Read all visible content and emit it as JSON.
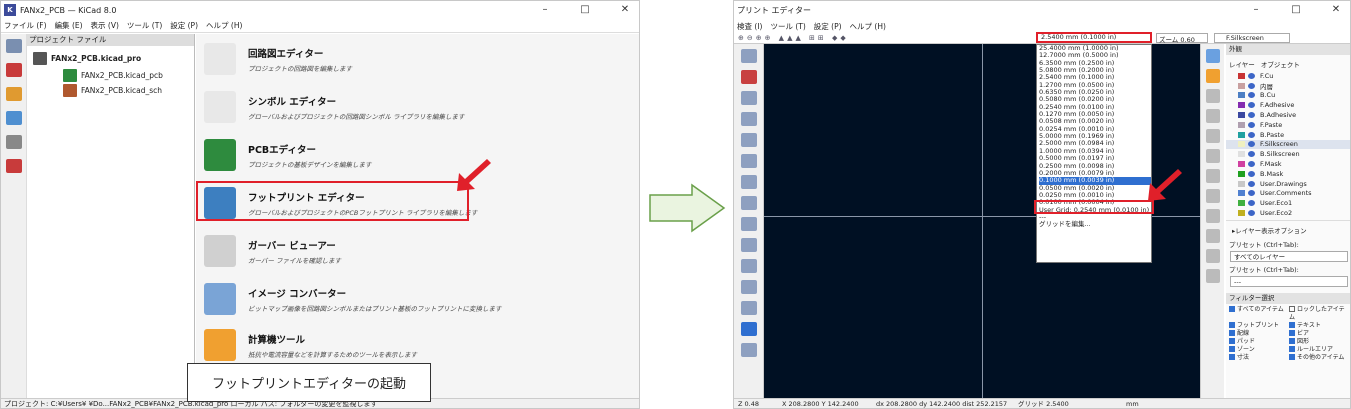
{
  "left_window": {
    "app_icon": "K",
    "title": "FANx2_PCB — KiCad 8.0",
    "menu": [
      "ファイル (F)",
      "編集 (E)",
      "表示 (V)",
      "ツール (T)",
      "設定 (P)",
      "ヘルプ (H)"
    ],
    "tree_header": "プロジェクト ファイル",
    "tree": [
      "FANx2_PCB.kicad_pro",
      "FANx2_PCB.kicad_pcb",
      "FANx2_PCB.kicad_sch"
    ],
    "launchers": [
      {
        "title": "回路図エディター",
        "desc": "プロジェクトの回路図を編集します",
        "icon": "schematic-icon",
        "color": "#e8e8e8"
      },
      {
        "title": "シンボル エディター",
        "desc": "グローバルおよびプロジェクトの回路図シンボル ライブラリを編集します",
        "icon": "symbol-icon",
        "color": "#e8e8e8"
      },
      {
        "title": "PCBエディター",
        "desc": "プロジェクトの基板デザインを編集します",
        "icon": "pcb-icon",
        "color": "#2e8b3e"
      },
      {
        "title": "フットプリント エディター",
        "desc": "グローバルおよびプロジェクトのPCBフットプリント ライブラリを編集します",
        "icon": "footprint-icon",
        "color": "#3d7fc0"
      },
      {
        "title": "ガーバー ビューアー",
        "desc": "ガーバー ファイルを確認します",
        "icon": "gerber-icon",
        "color": "#d0d0d0"
      },
      {
        "title": "イメージ コンバーター",
        "desc": "ビットマップ画像を回路図シンボルまたはプリント基板のフットプリントに変換します",
        "icon": "image-converter-icon",
        "color": "#7aa4d6"
      },
      {
        "title": "計算機ツール",
        "desc": "抵抗や電流容量などを計算するためのツールを表示します",
        "icon": "calculator-icon",
        "color": "#f0a030"
      }
    ],
    "status": "プロジェクト: C:¥Users¥        ¥Do...FANx2_PCB¥FANx2_PCB.kicad_pro    ローカル パス: フォルダーの変更を監視します",
    "callout": "フットプリントエディターの起動"
  },
  "right_window": {
    "title": "プリント エディター",
    "menu": [
      "検査 (I)",
      "ツール (T)",
      "設定 (P)",
      "ヘルプ (H)"
    ],
    "grid_select": "2.5400 mm (0.1000 in)",
    "zoom_select": "ズーム 0.60",
    "layer_select": "F.Silkscreen",
    "grid_options": [
      "25.4000 mm (1.0000 in)",
      "12.7000 mm (0.5000 in)",
      "6.3500 mm (0.2500 in)",
      "5.0800 mm (0.2000 in)",
      "2.5400 mm (0.1000 in)",
      "1.2700 mm (0.0500 in)",
      "0.6350 mm (0.0250 in)",
      "0.5080 mm (0.0200 in)",
      "0.2540 mm (0.0100 in)",
      "0.1270 mm (0.0050 in)",
      "0.0508 mm (0.0020 in)",
      "0.0254 mm (0.0010 in)",
      "5.0000 mm (0.1969 in)",
      "2.5000 mm (0.0984 in)",
      "1.0000 mm (0.0394 in)",
      "0.5000 mm (0.0197 in)",
      "0.2500 mm (0.0098 in)",
      "0.2000 mm (0.0079 in)",
      "0.1000 mm (0.0039 in)",
      "0.0500 mm (0.0020 in)",
      "0.0250 mm (0.0010 in)",
      "0.0100 mm (0.0004 in)",
      "User Grid: 0.2540 mm (0.0100 in)",
      "---",
      "グリッドを編集..."
    ],
    "grid_selected_index": 18,
    "appearance_title": "外観",
    "tabs": [
      "レイヤー",
      "オブジェクト"
    ],
    "layers": [
      {
        "name": "F.Cu",
        "color": "#c83434"
      },
      {
        "name": "内層",
        "color": "#c8a0a0"
      },
      {
        "name": "B.Cu",
        "color": "#4d7fc4"
      },
      {
        "name": "F.Adhesive",
        "color": "#842cb0"
      },
      {
        "name": "B.Adhesive",
        "color": "#3a48a0"
      },
      {
        "name": "F.Paste",
        "color": "#b0a0b0"
      },
      {
        "name": "B.Paste",
        "color": "#20a0a0"
      },
      {
        "name": "F.Silkscreen",
        "color": "#f0f0c0"
      },
      {
        "name": "B.Silkscreen",
        "color": "#e0e0e0"
      },
      {
        "name": "F.Mask",
        "color": "#d040a0"
      },
      {
        "name": "B.Mask",
        "color": "#20a020"
      },
      {
        "name": "User.Drawings",
        "color": "#c8c8c8"
      },
      {
        "name": "User.Comments",
        "color": "#5080d0"
      },
      {
        "name": "User.Eco1",
        "color": "#40b040"
      },
      {
        "name": "User.Eco2",
        "color": "#c0b020"
      }
    ],
    "layer_display_options": "▸レイヤー表示オプション",
    "preset_label": "プリセット (Ctrl+Tab):",
    "preset_value": "すべてのレイヤー",
    "viewport_label": "プリセット (Ctrl+Tab):",
    "viewport_value": "---",
    "filter_title": "フィルター選択",
    "filters": [
      {
        "label": "すべてのアイテム",
        "checked": true
      },
      {
        "label": "ロックしたアイテム",
        "checked": false
      },
      {
        "label": "フットプリント",
        "checked": true
      },
      {
        "label": "テキスト",
        "checked": true
      },
      {
        "label": "配線",
        "checked": true
      },
      {
        "label": "ビア",
        "checked": true
      },
      {
        "label": "パッド",
        "checked": true
      },
      {
        "label": "図形",
        "checked": true
      },
      {
        "label": "ゾーン",
        "checked": true
      },
      {
        "label": "ルールエリア",
        "checked": true
      },
      {
        "label": "寸法",
        "checked": true
      },
      {
        "label": "その他のアイテム",
        "checked": true
      }
    ],
    "status": [
      "Z 0.48",
      "X 208.2800  Y 142.2400",
      "dx 208.2800  dy 142.2400  dist 252.2157",
      "グリッド 2.5400",
      "mm"
    ]
  }
}
